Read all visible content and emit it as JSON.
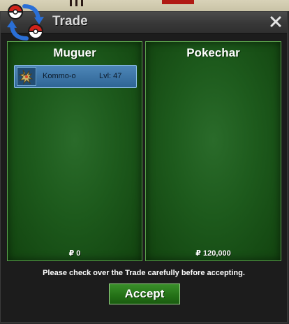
{
  "window": {
    "title": "Trade"
  },
  "icons": {
    "title": "trade-arrows-icon",
    "close": "close-icon",
    "currency": "pokedollar-symbol"
  },
  "left_panel": {
    "trainer": "Muguer",
    "money": "₽ 0",
    "pokemon": [
      {
        "name": "Kommo-o",
        "level": "Lvl: 47"
      }
    ]
  },
  "right_panel": {
    "trainer": "Pokechar",
    "money": "₽ 120,000",
    "pokemon": []
  },
  "footer": {
    "notice": "Please check over the Trade carefully before accepting.",
    "accept_label": "Accept"
  },
  "colors": {
    "panel_green": "#1d5a1c",
    "panel_border": "#5ba34c",
    "item_blue": "#3f77a8",
    "accept_green": "#237016"
  }
}
